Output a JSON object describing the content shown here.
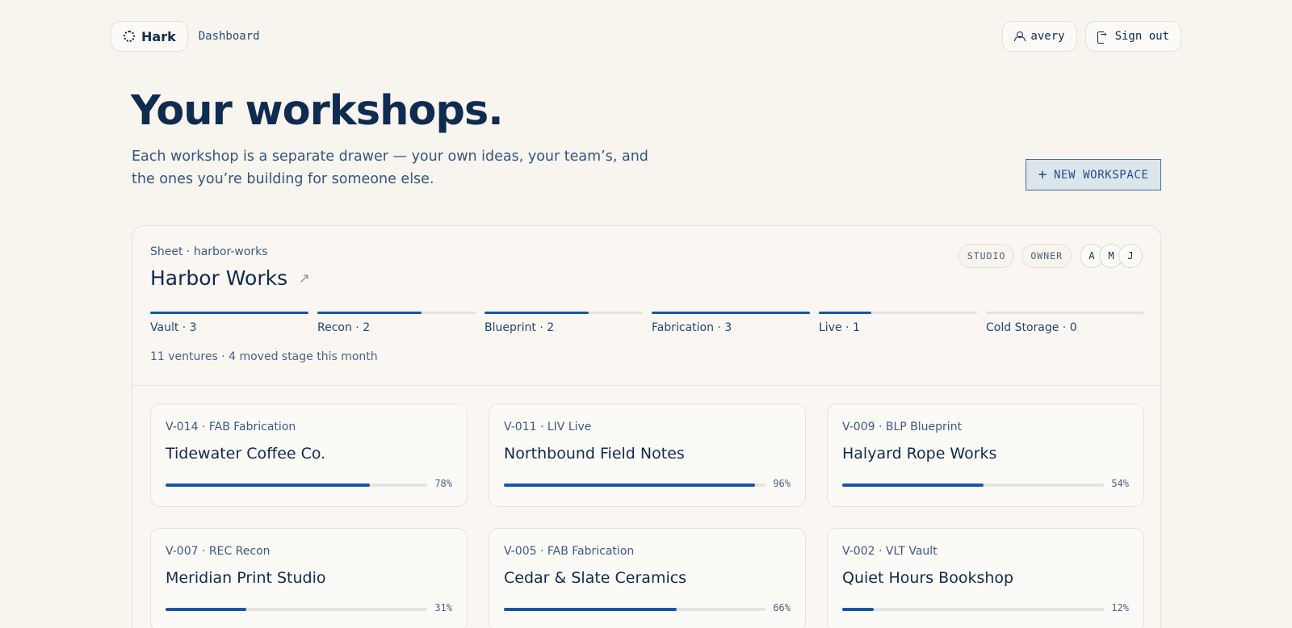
{
  "header": {
    "brand": "Hark",
    "nav_dashboard": "Dashboard",
    "user": "avery",
    "sign_out": "Sign out"
  },
  "hero": {
    "title": "Your workshops.",
    "subtitle": "Each workshop is a separate drawer — your own ideas, your team’s, and the ones you’re building for someone else.",
    "new_workspace": "NEW WORKSPACE"
  },
  "sheet": {
    "eyebrow": "Sheet · harbor-works",
    "title": "Harbor Works",
    "chips": [
      "STUDIO",
      "OWNER"
    ],
    "avatars": [
      "A",
      "M",
      "J"
    ],
    "stages": [
      {
        "label": "Vault · 3",
        "fill": 1.0
      },
      {
        "label": "Recon · 2",
        "fill": 0.66
      },
      {
        "label": "Blueprint · 2",
        "fill": 0.66
      },
      {
        "label": "Fabrication · 3",
        "fill": 1.0
      },
      {
        "label": "Live · 1",
        "fill": 0.33
      },
      {
        "label": "Cold Storage · 0",
        "fill": 0
      }
    ],
    "summary": "11 ventures · 4 moved stage this month"
  },
  "ventures": [
    {
      "eyebrow": "V-014 · FAB Fabrication",
      "title": "Tidewater Coffee Co.",
      "progress": 78,
      "pct_label": "78%"
    },
    {
      "eyebrow": "V-011 · LIV Live",
      "title": "Northbound Field Notes",
      "progress": 96,
      "pct_label": "96%"
    },
    {
      "eyebrow": "V-009 · BLP Blueprint",
      "title": "Halyard Rope Works",
      "progress": 54,
      "pct_label": "54%"
    },
    {
      "eyebrow": "V-007 · REC Recon",
      "title": "Meridian Print Studio",
      "progress": 31,
      "pct_label": "31%"
    },
    {
      "eyebrow": "V-005 · FAB Fabrication",
      "title": "Cedar & Slate Ceramics",
      "progress": 66,
      "pct_label": "66%"
    },
    {
      "eyebrow": "V-002 · VLT Vault",
      "title": "Quiet Hours Bookshop",
      "progress": 12,
      "pct_label": "12%"
    }
  ],
  "colors": {
    "accent": "#1a55a5",
    "ink": "#0f2b50",
    "background": "#f8f4ee"
  }
}
